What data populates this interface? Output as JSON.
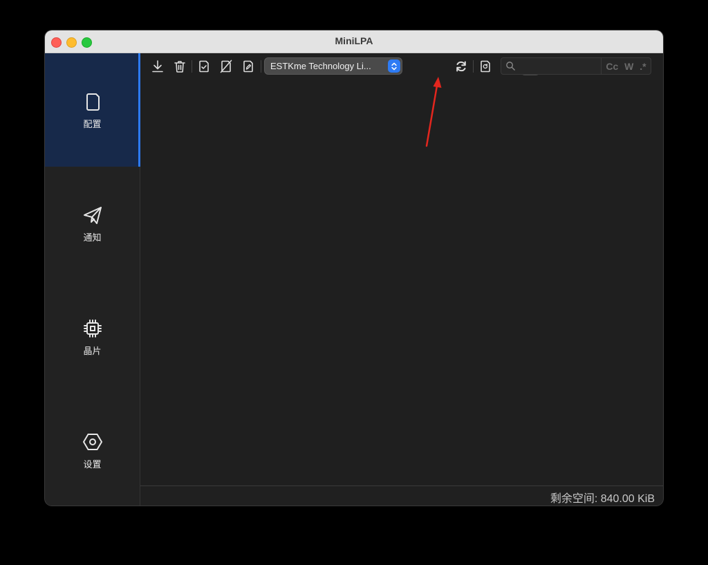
{
  "window": {
    "title": "MiniLPA"
  },
  "sidebar": {
    "items": [
      {
        "label": "配置",
        "icon": "sim-card-icon",
        "active": true
      },
      {
        "label": "通知",
        "icon": "paper-plane-icon",
        "active": false
      },
      {
        "label": "晶片",
        "icon": "chip-icon",
        "active": false
      },
      {
        "label": "设置",
        "icon": "hex-nut-icon",
        "active": false
      }
    ]
  },
  "toolbar": {
    "buttons": [
      "download-icon",
      "trash-icon",
      "sim-check-icon",
      "sim-disabled-icon",
      "sim-edit-icon"
    ],
    "device_select": {
      "value": "ESTKme Technology Li..."
    },
    "buttons_after": [
      "refresh-icon",
      "sim-refresh-icon",
      "send-icon",
      "eye-icon"
    ],
    "search": {
      "value": "",
      "placeholder": "",
      "options": [
        "Cc",
        "W",
        ".*"
      ]
    }
  },
  "status": {
    "free_space": "剩余空间: 840.00 KiB"
  },
  "colors": {
    "accent": "#2d7bf4",
    "sidebar_active": "#17294a",
    "annotation": "#e3261e"
  }
}
